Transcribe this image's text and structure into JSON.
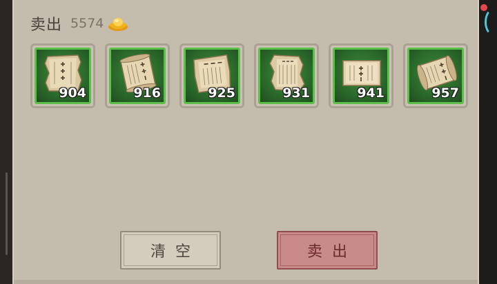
{
  "panel": {
    "title": "卖出",
    "total": "5574",
    "currency_icon": "gold-ingot-icon"
  },
  "items": [
    {
      "qty": "904",
      "icon": "paper-scroll-icon"
    },
    {
      "qty": "916",
      "icon": "paper-scroll-icon"
    },
    {
      "qty": "925",
      "icon": "paper-scroll-icon"
    },
    {
      "qty": "931",
      "icon": "paper-scroll-icon"
    },
    {
      "qty": "941",
      "icon": "paper-scroll-icon"
    },
    {
      "qty": "957",
      "icon": "paper-scroll-icon"
    }
  ],
  "buttons": {
    "clear_label": "清空",
    "sell_label": "卖出"
  },
  "colors": {
    "panel_bg": "#c4bcad",
    "slot_border": "#5cbf49",
    "slot_bg": "#2c6c2c",
    "sell_button": "#c98a8a",
    "clear_button": "#d4cdbd"
  }
}
